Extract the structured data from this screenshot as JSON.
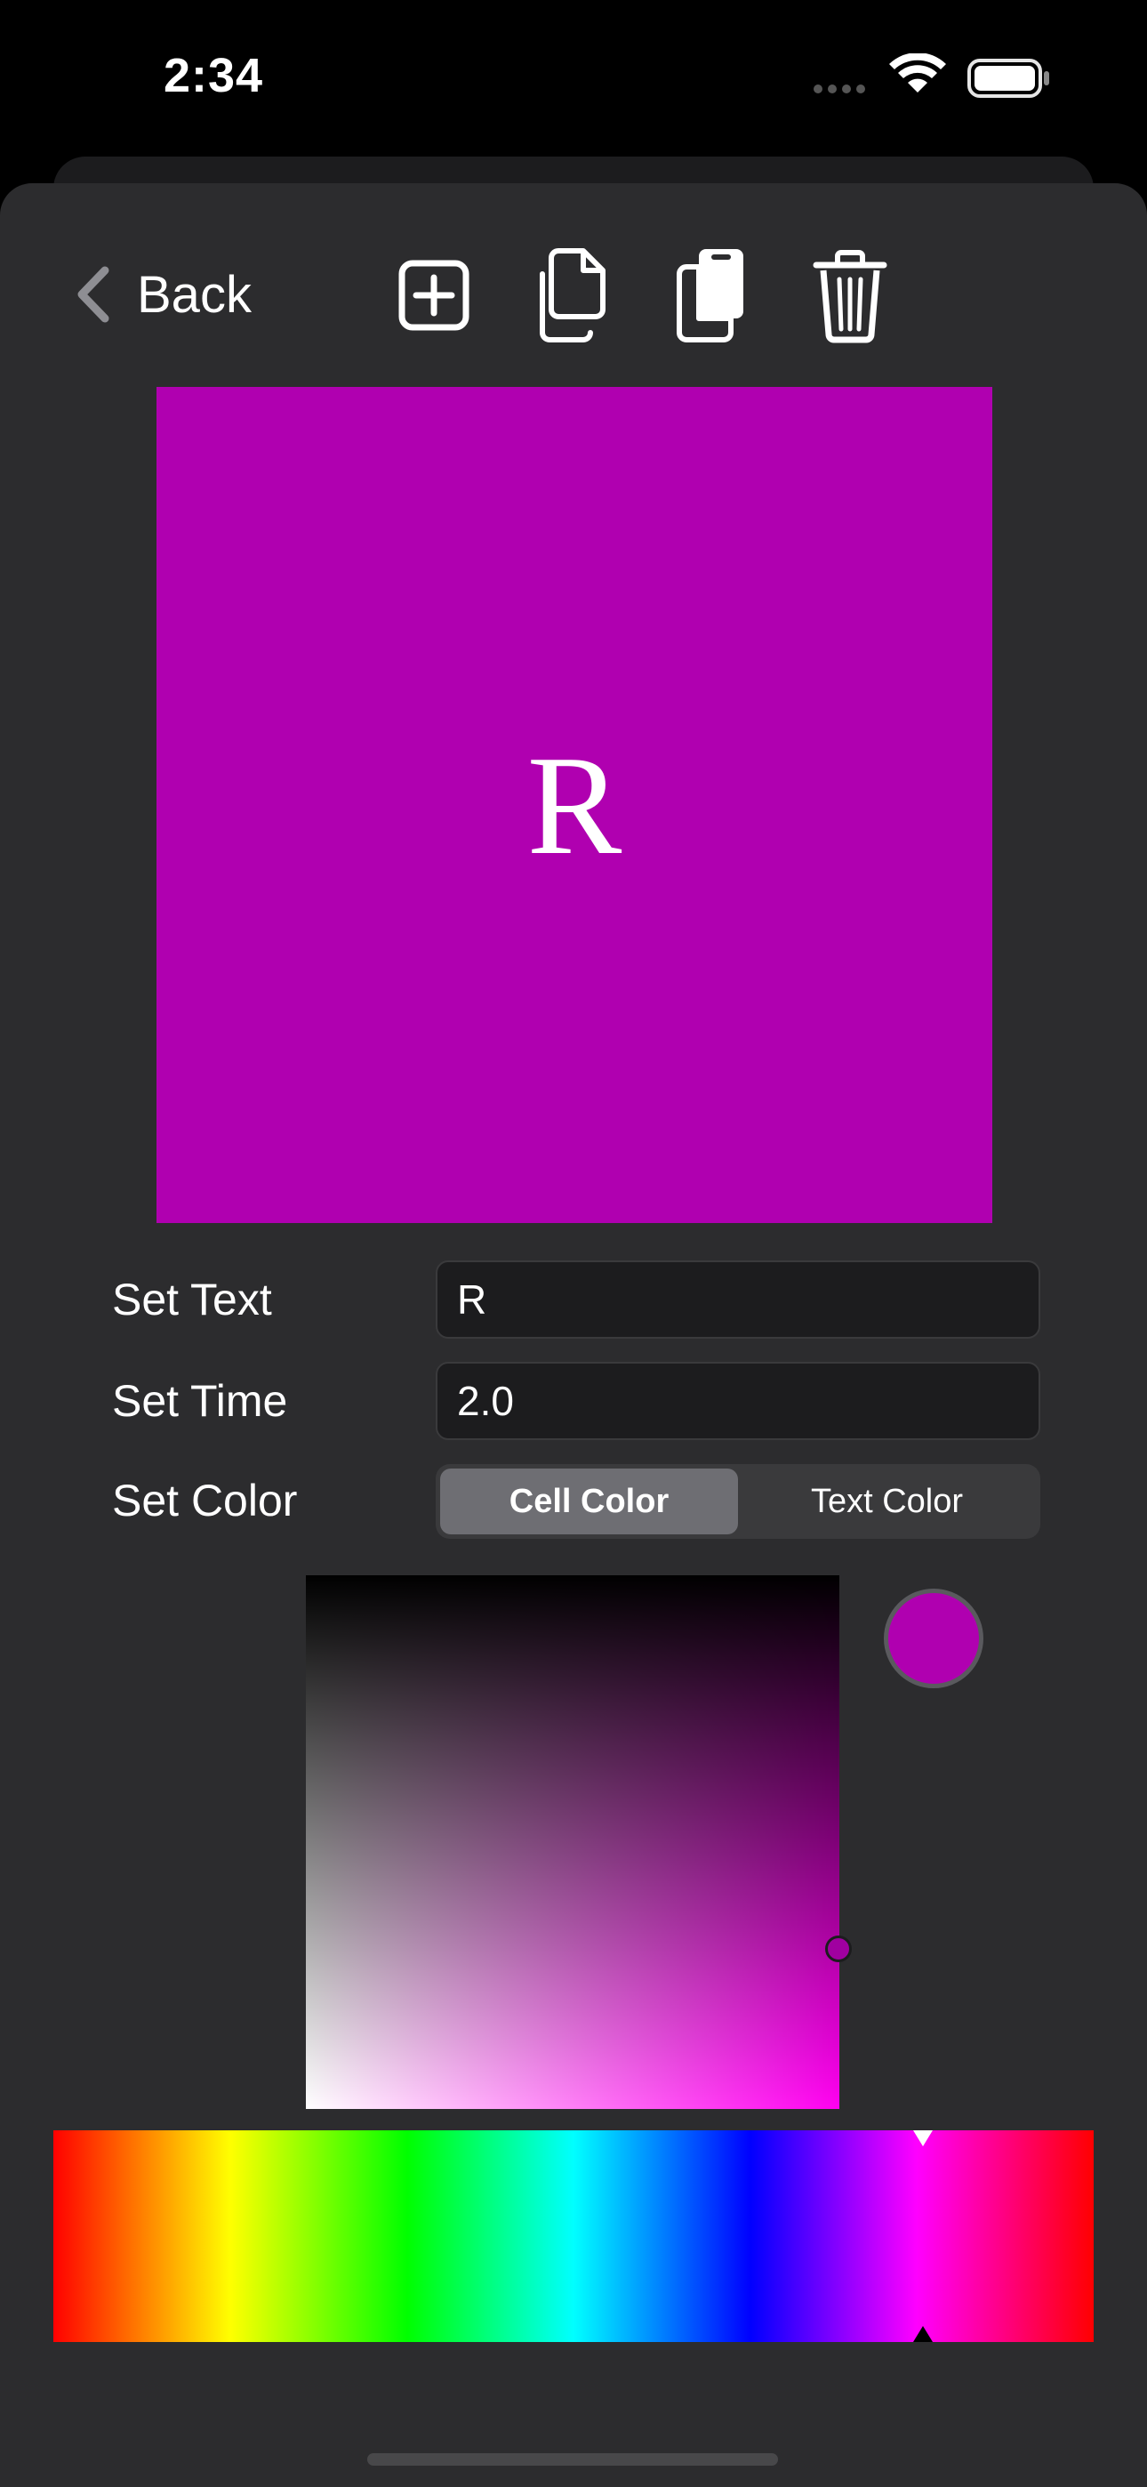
{
  "status_bar": {
    "time": "2:34",
    "icons": [
      "cellular-dots-icon",
      "wifi-icon",
      "battery-icon"
    ]
  },
  "toolbar": {
    "back_label": "Back",
    "icons": [
      "add-square-icon",
      "duplicate-icon",
      "copy-icon",
      "trash-icon"
    ]
  },
  "preview": {
    "text": "R",
    "cell_color": "#b000b0",
    "text_color": "#ffffff"
  },
  "form": {
    "text_label": "Set Text",
    "text_value": "R",
    "time_label": "Set Time",
    "time_value": "2.0",
    "color_label": "Set Color",
    "color_segments": [
      "Cell Color",
      "Text Color"
    ],
    "selected_segment": "Cell Color"
  },
  "color_picker": {
    "selected_color": "#b000b0",
    "hue_degrees": 300
  },
  "colors": {
    "background": "#000000",
    "sheet": "#2c2c2e",
    "accent_magenta": "#b000b0"
  }
}
